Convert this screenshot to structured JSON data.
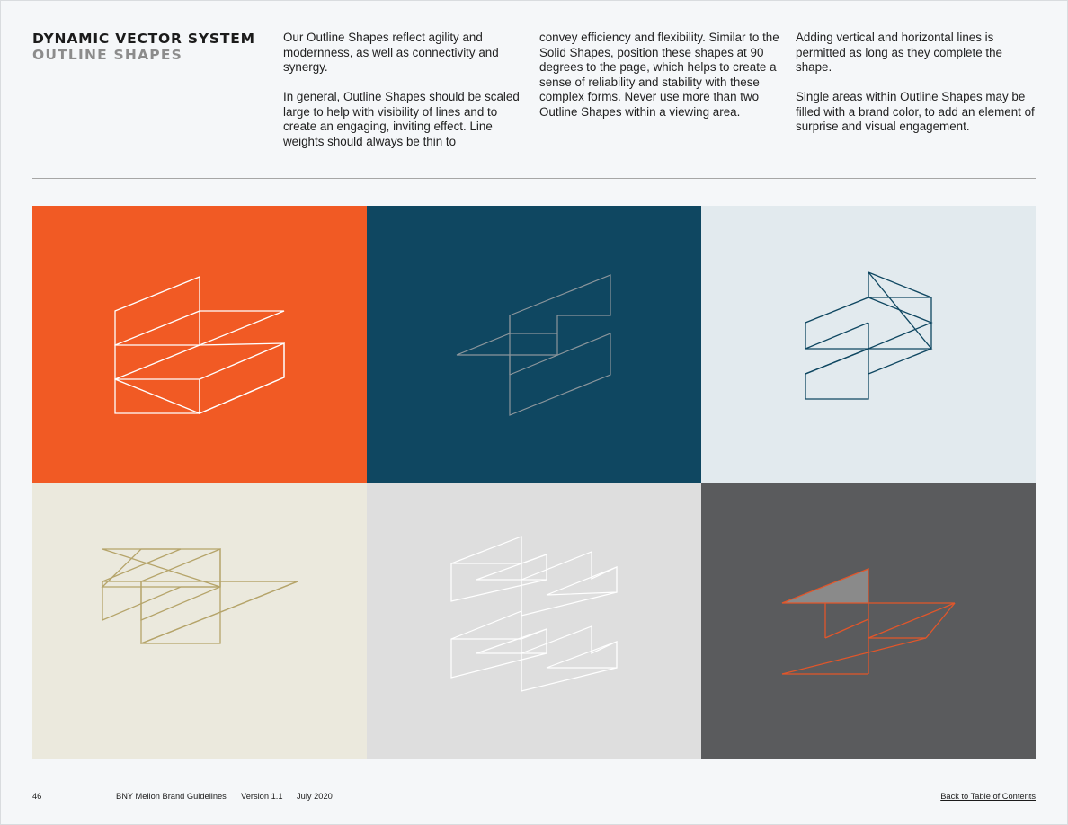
{
  "header": {
    "title": "DYNAMIC VECTOR SYSTEM",
    "subtitle": "OUTLINE SHAPES"
  },
  "body_text": {
    "col1_p1": "Our Outline Shapes reflect agility and modernness, as well as connectivity and synergy.",
    "col1_p2": "In general, Outline Shapes should be scaled large to help with visibility of lines and to create an engaging, inviting effect. Line weights should always be thin to",
    "col2_p1": "convey efficiency and flexibility. Similar to the Solid Shapes, position these shapes at 90 degrees to the page, which helps to create a sense of reliability and stability with these complex forms. Never use more than two Outline Shapes within a viewing area.",
    "col3_p1": "Adding vertical and horizontal lines is permitted as long as they complete the shape.",
    "col3_p2": "Single areas within Outline Shapes may be filled with a brand color, to add an element of surprise and visual engagement."
  },
  "tiles": [
    {
      "background": "#f15a24",
      "stroke": "#ffffff"
    },
    {
      "background": "#0f4761",
      "stroke": "#8c969c"
    },
    {
      "background": "#e2eaee",
      "stroke": "#0f4761"
    },
    {
      "background": "#ebe9dd",
      "stroke": "#b5a46a"
    },
    {
      "background": "#dedede",
      "stroke": "#ffffff"
    },
    {
      "background": "#5a5b5d",
      "stroke": "#e2562a",
      "fill": "#8a8a8a"
    }
  ],
  "footer": {
    "page_number": "46",
    "guide_name": "BNY Mellon Brand Guidelines",
    "version": "Version 1.1",
    "date": "July 2020",
    "back_link": "Back to Table of Contents"
  }
}
